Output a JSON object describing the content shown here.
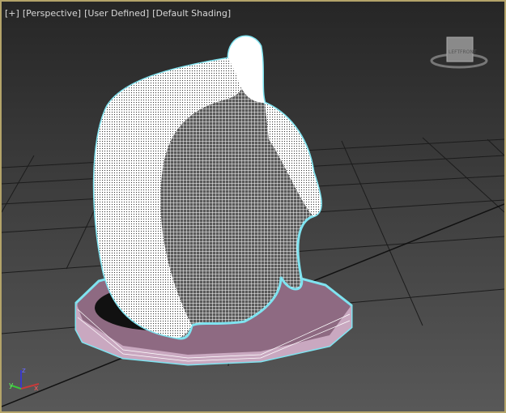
{
  "viewport": {
    "labels": {
      "plus": "[+]",
      "view": "[Perspective]",
      "camera": "[User Defined]",
      "shading": "[Default Shading]"
    },
    "viewcube": {
      "face_left": "LEFT",
      "face_front": "FRONT"
    },
    "axis_gizmo": {
      "x": "x",
      "y": "y",
      "z": "z"
    },
    "colors": {
      "border": "#b4a46a",
      "selection_outline": "#7fe3f0",
      "pedestal": "#8e6a82",
      "wire": "#ffffff"
    }
  }
}
